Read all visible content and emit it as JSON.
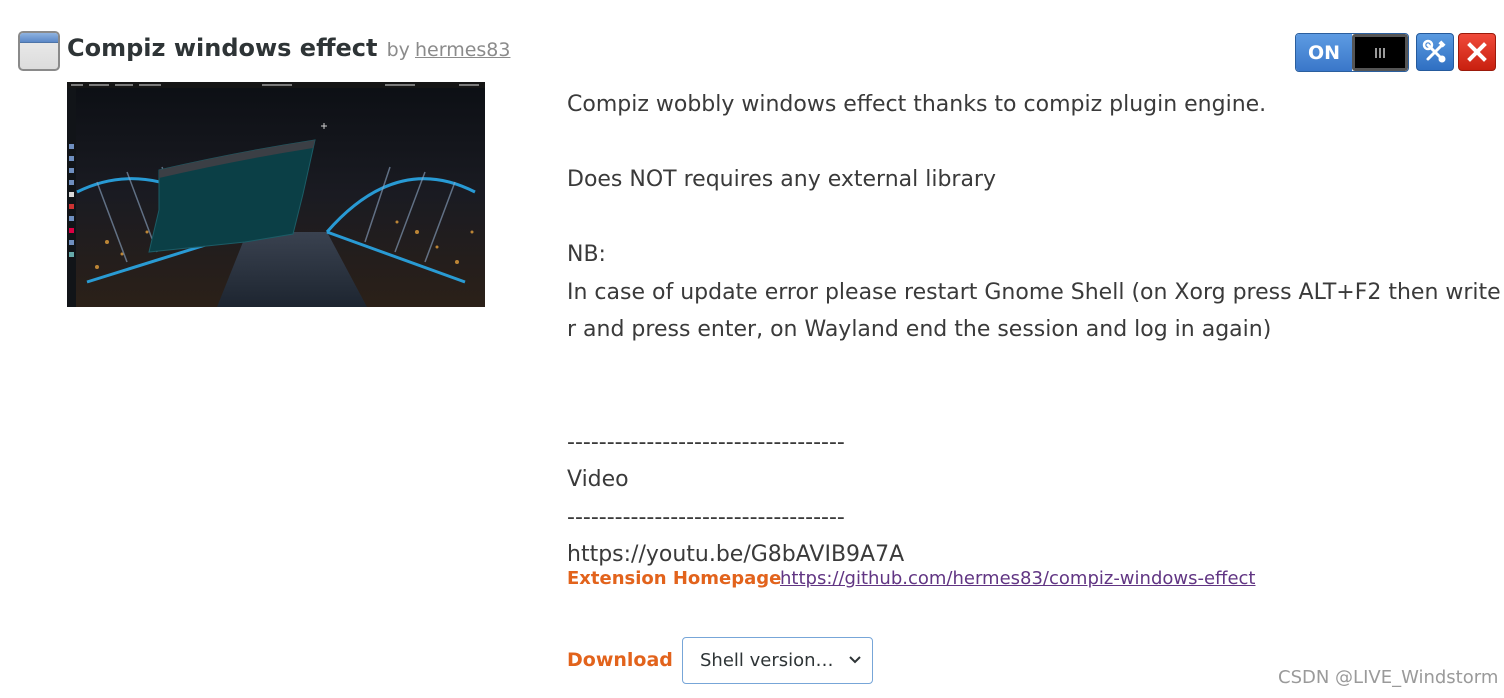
{
  "extension": {
    "name": "Compiz windows effect",
    "by": "by",
    "author": "hermes83"
  },
  "controls": {
    "toggle_label": "ON",
    "toggle_state": "on",
    "accent_color": "#3a77c9",
    "remove_color": "#d42a1a",
    "prefs_icon": "wrench-screwdriver-icon",
    "remove_icon": "close-icon"
  },
  "screenshot": {
    "alt_icon": "screenshot-image"
  },
  "description": {
    "lines": [
      "Compiz wobbly windows effect thanks to compiz plugin engine.",
      "",
      "Does NOT requires any external library",
      "",
      "NB:",
      "In case of update error please restart Gnome Shell (on Xorg press ALT+F2 then write r and press enter, on Wayland end the session and log in again)",
      "",
      "",
      "-----------------------------------",
      "Video",
      "-----------------------------------",
      "https://youtu.be/G8bAVIB9A7A"
    ]
  },
  "homepage": {
    "label": "Extension Homepage",
    "url": "https://github.com/hermes83/compiz-windows-effect"
  },
  "download": {
    "label": "Download",
    "select_value": "Shell version…"
  },
  "watermark": "CSDN @LIVE_Windstorm"
}
